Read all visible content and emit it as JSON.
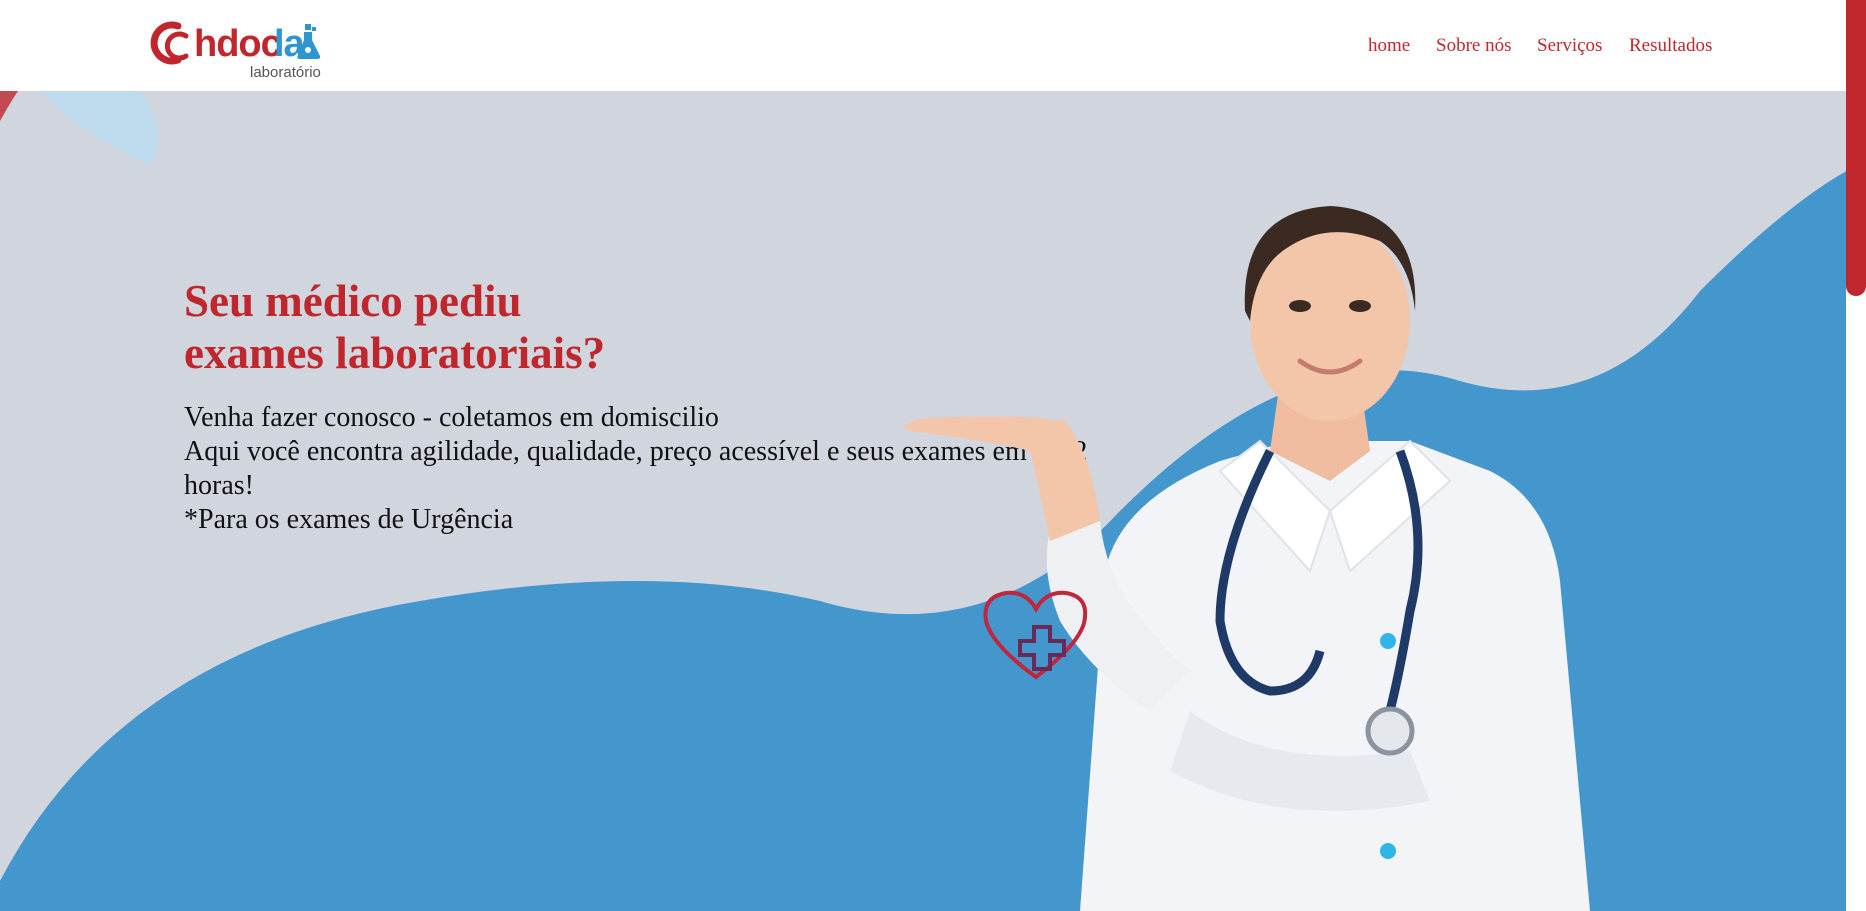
{
  "brand": {
    "name_part1": "hdoc",
    "name_part2": "la",
    "subtitle": "laboratório",
    "colors": {
      "red": "#c0272d",
      "blue": "#2f95d0"
    }
  },
  "nav": {
    "items": [
      "home",
      "Sobre nós",
      "Serviços",
      "Resultados"
    ]
  },
  "hero": {
    "title_line1": "Seu médico pediu",
    "title_line2": "exames laboratoriais?",
    "lines": [
      "Venha fazer conosco - coletamos em domiscilio",
      "Aqui você encontra agilidade, qualidade, preço acessível e seus exames em até 2 horas!",
      "*Para os exames de Urgência"
    ],
    "colors": {
      "background": "#d1d5de",
      "wave": "#4497cd",
      "title": "#c0272d"
    }
  },
  "icons": {
    "logo_mark": "hdoc-logo-icon",
    "flask": "flask-icon",
    "heart": "heart-cross-icon",
    "doctor": "doctor-illustration"
  }
}
